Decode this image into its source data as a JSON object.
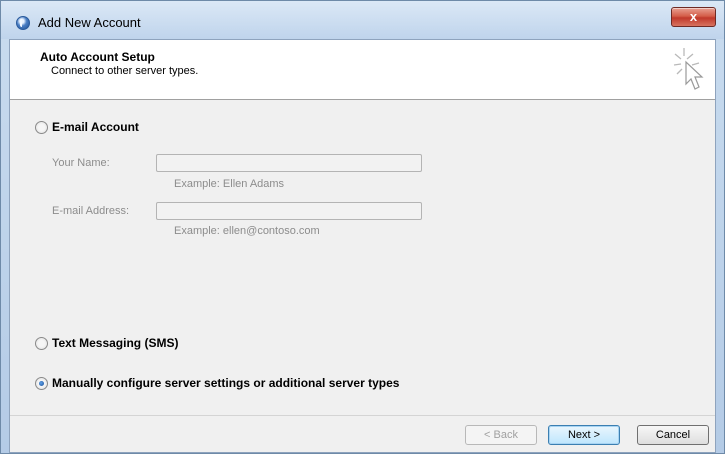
{
  "window": {
    "title": "Add New Account",
    "close_label": "x"
  },
  "header": {
    "title": "Auto Account Setup",
    "subtitle": "Connect to other server types."
  },
  "options": {
    "email_account": {
      "label": "E-mail Account",
      "selected": false
    },
    "sms": {
      "label": "Text Messaging (SMS)",
      "selected": false
    },
    "manual": {
      "label": "Manually configure server settings or additional server types",
      "selected": true
    }
  },
  "form": {
    "your_name": {
      "label": "Your Name:",
      "value": "",
      "example": "Example: Ellen Adams"
    },
    "email_address": {
      "label": "E-mail Address:",
      "value": "",
      "example": "Example: ellen@contoso.com"
    }
  },
  "buttons": {
    "back": "< Back",
    "next": "Next >",
    "cancel": "Cancel"
  }
}
